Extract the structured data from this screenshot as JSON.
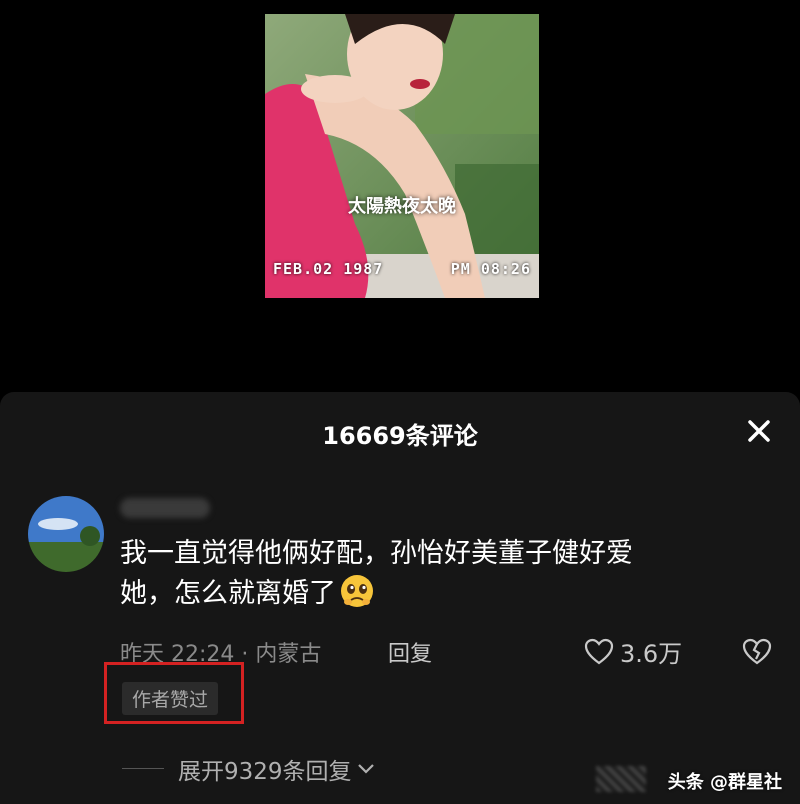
{
  "video": {
    "caption": "太陽熱夜太晚",
    "date_stamp": "FEB.02 1987",
    "time_stamp": "PM 08:26"
  },
  "sheet": {
    "title": "16669条评论",
    "close_icon": "close-icon"
  },
  "comment": {
    "text_line1": "我一直觉得他俩好配，孙怡好美董子健好爱",
    "text_line2": "她，怎么就离婚了",
    "emoji": "pleading-face-emoji",
    "meta": "昨天 22:24 · 内蒙古",
    "reply_label": "回复",
    "like_count": "3.6万",
    "badge": "作者赞过",
    "expand_label": "展开9329条回复"
  },
  "watermark": {
    "text": "头条 @群星社"
  },
  "colors": {
    "background": "#000000",
    "sheet": "#161616",
    "highlight_box": "#d42222",
    "video_dress": "#e0336a"
  }
}
